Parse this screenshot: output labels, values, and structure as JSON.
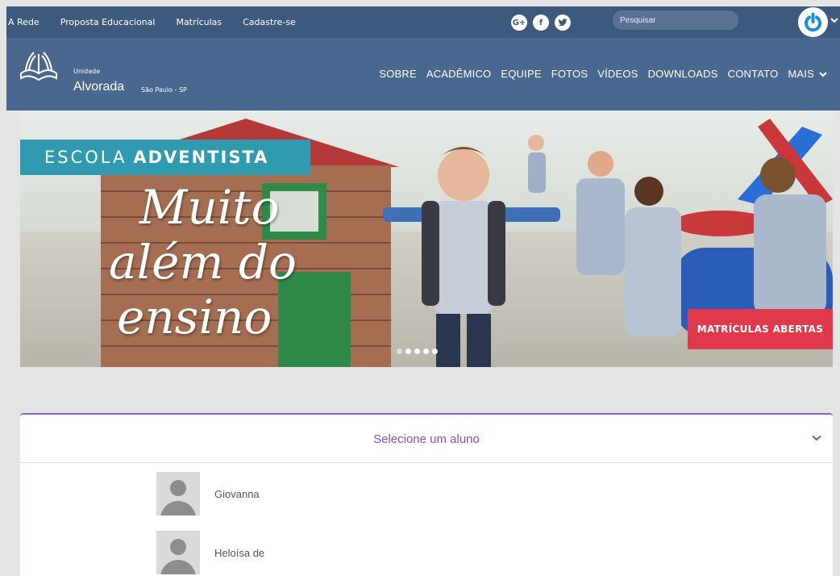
{
  "topbar": {
    "links": [
      "A Rede",
      "Proposta Educacional",
      "Matrículas",
      "Cadastre-se"
    ],
    "social": [
      {
        "label": "G+",
        "icon": "google-plus-icon"
      },
      {
        "label": "f",
        "icon": "facebook-icon"
      },
      {
        "label": "t",
        "icon": "twitter-icon"
      }
    ],
    "search_placeholder": "Pesquisar"
  },
  "unit": {
    "label": "Unidade",
    "name": "Alvorada",
    "city": "São Paulo - SP"
  },
  "menu": [
    "SOBRE",
    "ACADÊMICO",
    "EQUIPE",
    "FOTOS",
    "VÍDEOS",
    "DOWNLOADS",
    "CONTATO",
    "MAIS"
  ],
  "hero": {
    "tag_prefix": "ESCOLA",
    "tag_bold": "ADVENTISTA",
    "headline": [
      "Muito",
      "além do",
      "ensino"
    ],
    "cta": "MATRÍCULAS ABERTAS",
    "slides": 5,
    "active_slide": 4
  },
  "selector": {
    "title": "Selecione um aluno",
    "students": [
      "Giovanna",
      "Heloísa de"
    ]
  },
  "colors": {
    "topbar": "#3d5a7e",
    "navbar": "#4a6790",
    "accent": "#8e4fb5",
    "cta": "#e0394c",
    "teal": "#2f9ab0"
  }
}
